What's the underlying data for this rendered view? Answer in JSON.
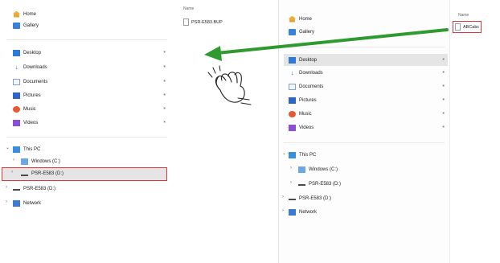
{
  "left_explorer": {
    "nav": {
      "home": "Home",
      "gallery": "Gallery",
      "desktop": "Desktop",
      "downloads": "Downloads",
      "documents": "Documents",
      "pictures": "Pictures",
      "music": "Music",
      "videos": "Videos",
      "this_pc": "This PC",
      "windows_c": "Windows (C:)",
      "psr_d_selected": "PSR-E583 (D:)",
      "psr_d": "PSR-E583 (D:)",
      "network": "Network"
    },
    "files": {
      "column_header": "Name",
      "items": [
        "PSR-E583.BUP"
      ]
    }
  },
  "right_explorer": {
    "nav": {
      "home": "Home",
      "gallery": "Gallery",
      "desktop": "Desktop",
      "downloads": "Downloads",
      "documents": "Documents",
      "pictures": "Pictures",
      "music": "Music",
      "videos": "Videos",
      "this_pc": "This PC",
      "windows_c": "Windows (C:)",
      "psr_d_1": "PSR-E583 (D:)",
      "psr_d_2": "PSR-E583 (D:)",
      "network": "Network"
    },
    "files": {
      "column_header": "Name",
      "items": [
        "ABCabc"
      ]
    }
  },
  "icons": {
    "pin": "pin-icon",
    "chevron": "chevron-icon",
    "arrow": "drag-arrow",
    "hand": "grab-hand-icon"
  },
  "colors": {
    "highlight": "#d63a3a",
    "arrow": "#2f9a2f",
    "selection": "#e5e5e5"
  }
}
